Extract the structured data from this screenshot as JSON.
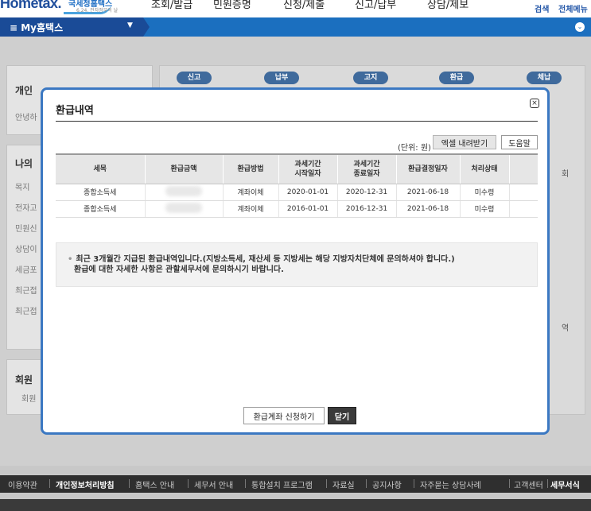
{
  "header": {
    "logo_text": "Hometax.",
    "logo_sub": "국세청홈택스",
    "logo_tag": "6.24. 전자정부의 날",
    "nav": [
      "조회/발급",
      "민원증명",
      "신청/제출",
      "신고/납부",
      "상담/제보"
    ],
    "search_label": "검색",
    "all_menu_label": "전체메뉴"
  },
  "bluebar": {
    "my_menu_label": "≡ My홈택스"
  },
  "background": {
    "panel1_title": "개인",
    "panel1_line": "안녕하",
    "panel2_title": "나의",
    "panel2_lines": [
      "목지",
      "전자고",
      "민원신",
      "상담이",
      "세금포",
      "최근접",
      "최근접"
    ],
    "panel3_title": "회원",
    "panel3_line": "회원",
    "pills": [
      "신고",
      "납부",
      "고지",
      "환급",
      "체납"
    ],
    "right_fragments": [
      "회",
      "역"
    ]
  },
  "modal": {
    "title": "환급내역",
    "close_symbol": "×",
    "unit_label": "(단위: 원)",
    "excel_button": "엑셀 내려받기",
    "help_button": "도움말",
    "columns": [
      "세목",
      "환급금액",
      "환급방법",
      "과세기간\n시작일자",
      "과세기간\n종료일자",
      "환급결정일자",
      "처리상태",
      ""
    ],
    "rows": [
      [
        "종합소득세",
        "",
        "계좌이체",
        "2020-01-01",
        "2020-12-31",
        "2021-06-18",
        "미수령",
        ""
      ],
      [
        "종합소득세",
        "",
        "계좌이체",
        "2016-01-01",
        "2016-12-31",
        "2021-06-18",
        "미수령",
        ""
      ]
    ],
    "notice_line1": "최근 3개월간 지급된 환급내역입니다.(지방소득세, 재산세 등 지방세는 해당 지방자치단체에 문의하셔야 합니다.)",
    "notice_line2": "환급에 대한 자세한 사항은 관할세무서에 문의하시기 바랍니다.",
    "apply_button": "환급계좌 신청하기",
    "close_button": "닫기"
  },
  "footer": {
    "links": [
      "이용약관",
      "개인정보처리방침",
      "홈택스 안내",
      "세무서 안내",
      "통합설치 프로그램",
      "자료실",
      "공지사항",
      "자주묻는 상담사례",
      "고객센터",
      "세무서식"
    ]
  }
}
